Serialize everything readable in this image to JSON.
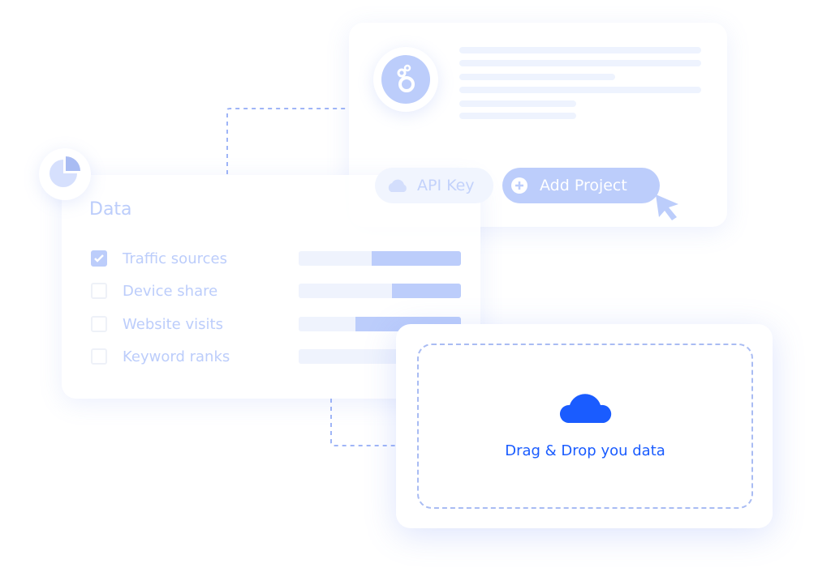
{
  "project_card": {
    "api_key_label": "API Key",
    "add_project_label": "Add Project",
    "logo_icon": "looker-studio-icon"
  },
  "data_panel": {
    "title": "Data",
    "items": [
      {
        "label": "Traffic sources",
        "checked": true,
        "share": 0.55
      },
      {
        "label": "Device share",
        "checked": false,
        "share": 0.425
      },
      {
        "label": "Website visits",
        "checked": false,
        "share": 0.65
      },
      {
        "label": "Keyword ranks",
        "checked": false,
        "share": 0.3
      }
    ]
  },
  "dropzone": {
    "label": "Drag & Drop you data"
  },
  "colors": {
    "accent": "#1a5cff",
    "soft": "#bccdfb",
    "track": "#eff3fd"
  }
}
